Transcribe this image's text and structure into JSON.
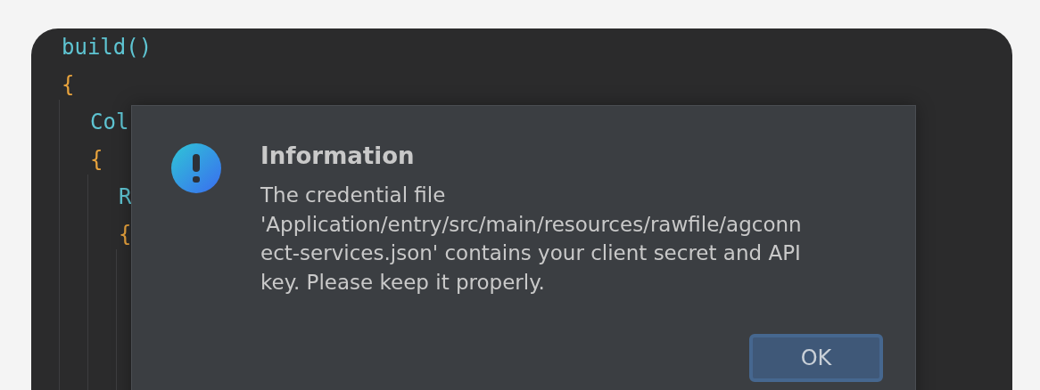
{
  "editor": {
    "code_lines": [
      {
        "text": "build()",
        "kind": "call"
      },
      {
        "text": "{",
        "kind": "brace",
        "children": [
          {
            "text": "Col",
            "kind": "call"
          },
          {
            "text": "{",
            "kind": "brace",
            "children": [
              {
                "text": "R",
                "kind": "call"
              },
              {
                "text": "{",
                "kind": "brace"
              }
            ]
          }
        ]
      }
    ]
  },
  "dialog": {
    "title": "Information",
    "kind": "info",
    "message_lines": [
      "The credential file",
      "'Application/entry/src/main/resources/rawfile/agconn",
      "ect-services.json' contains your client secret and API",
      "key. Please keep it properly."
    ],
    "buttons": [
      {
        "label": "OK",
        "default": true
      }
    ]
  }
}
